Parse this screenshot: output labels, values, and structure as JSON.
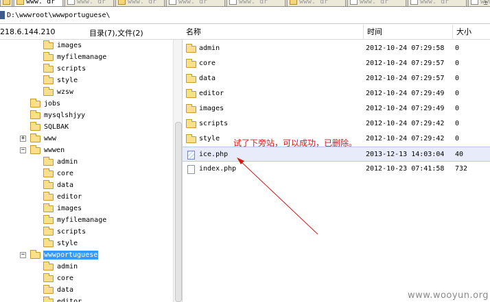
{
  "tabs": [
    {
      "label": "",
      "icon": "folder-icon",
      "active": false
    },
    {
      "label": "www. dr",
      "icon": "folder-icon",
      "active": true
    },
    {
      "label": "www. dr",
      "icon": "document-icon",
      "active": false
    },
    {
      "label": "www. dr",
      "icon": "folder-icon",
      "active": false
    },
    {
      "label": "www. dr",
      "icon": "document-icon",
      "active": false
    },
    {
      "label": "www. dr",
      "icon": "document-icon",
      "active": false
    },
    {
      "label": "www. dr",
      "icon": "folder-icon",
      "active": false
    },
    {
      "label": "www. dr",
      "icon": "document-icon",
      "active": false
    },
    {
      "label": "www. dr",
      "icon": "document-icon",
      "active": false
    },
    {
      "label": "www. dr",
      "icon": "document-icon",
      "active": false
    }
  ],
  "tab_close": "±",
  "address": {
    "path": "D:\\wwwroot\\wwwportuguese\\"
  },
  "tree_header": {
    "host": "218.6.144.210",
    "summary": "目录(7),文件(2)"
  },
  "columns": {
    "name": "名称",
    "time": "时间",
    "size": "大小"
  },
  "tree": [
    {
      "label": "images",
      "level": 2,
      "toggle": ""
    },
    {
      "label": "myfilemanage",
      "level": 2,
      "toggle": ""
    },
    {
      "label": "scripts",
      "level": 2,
      "toggle": ""
    },
    {
      "label": "style",
      "level": 2,
      "toggle": ""
    },
    {
      "label": "wzsw",
      "level": 2,
      "toggle": ""
    },
    {
      "label": "jobs",
      "level": 1,
      "toggle": ""
    },
    {
      "label": "mysqlshjyy",
      "level": 1,
      "toggle": ""
    },
    {
      "label": "SQLBAK",
      "level": 1,
      "toggle": ""
    },
    {
      "label": "www",
      "level": 1,
      "toggle": "+"
    },
    {
      "label": "wwwen",
      "level": 1,
      "toggle": "−"
    },
    {
      "label": "admin",
      "level": 2,
      "toggle": ""
    },
    {
      "label": "core",
      "level": 2,
      "toggle": ""
    },
    {
      "label": "data",
      "level": 2,
      "toggle": ""
    },
    {
      "label": "editor",
      "level": 2,
      "toggle": ""
    },
    {
      "label": "images",
      "level": 2,
      "toggle": ""
    },
    {
      "label": "myfilemanage",
      "level": 2,
      "toggle": ""
    },
    {
      "label": "scripts",
      "level": 2,
      "toggle": ""
    },
    {
      "label": "style",
      "level": 2,
      "toggle": ""
    },
    {
      "label": "wwwportuguese",
      "level": 1,
      "toggle": "−",
      "selected": true
    },
    {
      "label": "admin",
      "level": 2,
      "toggle": ""
    },
    {
      "label": "core",
      "level": 2,
      "toggle": ""
    },
    {
      "label": "data",
      "level": 2,
      "toggle": ""
    },
    {
      "label": "editor",
      "level": 2,
      "toggle": ""
    }
  ],
  "files": [
    {
      "name": "admin",
      "time": "2012-10-24 07:29:58",
      "size": "0",
      "type": "folder"
    },
    {
      "name": "core",
      "time": "2012-10-24 07:29:57",
      "size": "0",
      "type": "folder"
    },
    {
      "name": "data",
      "time": "2012-10-24 07:29:57",
      "size": "0",
      "type": "folder"
    },
    {
      "name": "editor",
      "time": "2012-10-24 07:29:49",
      "size": "0",
      "type": "folder"
    },
    {
      "name": "images",
      "time": "2012-10-24 07:29:49",
      "size": "0",
      "type": "folder"
    },
    {
      "name": "scripts",
      "time": "2012-10-24 07:29:42",
      "size": "0",
      "type": "folder"
    },
    {
      "name": "style",
      "time": "2012-10-24 07:29:42",
      "size": "0",
      "type": "folder"
    },
    {
      "name": "ice.php",
      "time": "2013-12-13 14:03:04",
      "size": "40",
      "type": "php",
      "highlighted": true
    },
    {
      "name": "index.php",
      "time": "2012-10-23 07:41:58",
      "size": "732",
      "type": "file"
    }
  ],
  "annotation": {
    "text": "试了下旁站，可以成功，已删除。",
    "color": "#d01818"
  },
  "watermark": "www.wooyun.org",
  "colors": {
    "selection": "#3399ff",
    "highlight_row": "#e8ecfa",
    "folder": "#fbe08b",
    "annotation": "#d01818"
  }
}
